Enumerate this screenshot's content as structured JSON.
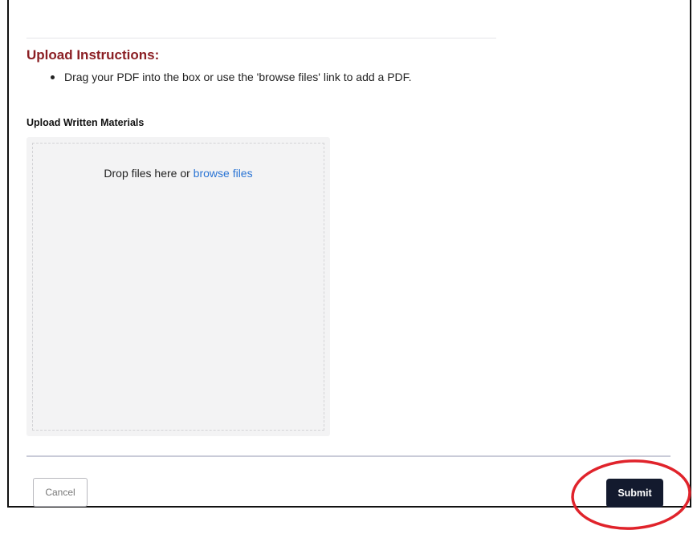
{
  "instructions": {
    "heading": "Upload Instructions:",
    "items": [
      "Drag your PDF into the box or use the 'browse files' link to add a PDF."
    ]
  },
  "upload": {
    "label": "Upload Written Materials",
    "drop_text": "Drop files here or ",
    "browse_link": "browse files"
  },
  "footer": {
    "cancel_label": "Cancel",
    "submit_label": "Submit"
  },
  "colors": {
    "heading": "#8b1f24",
    "link": "#2a74d4",
    "submit_bg": "#131a2e",
    "annotation": "#e0232b"
  }
}
